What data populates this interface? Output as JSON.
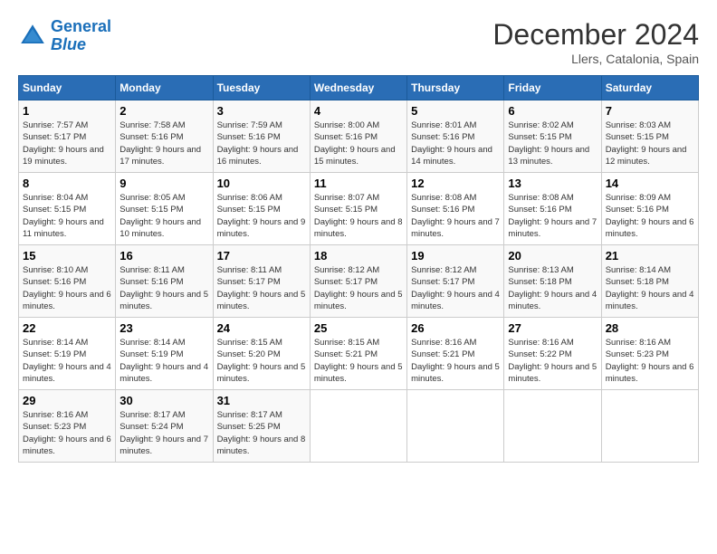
{
  "header": {
    "logo_line1": "General",
    "logo_line2": "Blue",
    "month": "December 2024",
    "location": "Llers, Catalonia, Spain"
  },
  "weekdays": [
    "Sunday",
    "Monday",
    "Tuesday",
    "Wednesday",
    "Thursday",
    "Friday",
    "Saturday"
  ],
  "weeks": [
    [
      {
        "day": "1",
        "info": "Sunrise: 7:57 AM\nSunset: 5:17 PM\nDaylight: 9 hours and 19 minutes."
      },
      {
        "day": "2",
        "info": "Sunrise: 7:58 AM\nSunset: 5:16 PM\nDaylight: 9 hours and 17 minutes."
      },
      {
        "day": "3",
        "info": "Sunrise: 7:59 AM\nSunset: 5:16 PM\nDaylight: 9 hours and 16 minutes."
      },
      {
        "day": "4",
        "info": "Sunrise: 8:00 AM\nSunset: 5:16 PM\nDaylight: 9 hours and 15 minutes."
      },
      {
        "day": "5",
        "info": "Sunrise: 8:01 AM\nSunset: 5:16 PM\nDaylight: 9 hours and 14 minutes."
      },
      {
        "day": "6",
        "info": "Sunrise: 8:02 AM\nSunset: 5:15 PM\nDaylight: 9 hours and 13 minutes."
      },
      {
        "day": "7",
        "info": "Sunrise: 8:03 AM\nSunset: 5:15 PM\nDaylight: 9 hours and 12 minutes."
      }
    ],
    [
      {
        "day": "8",
        "info": "Sunrise: 8:04 AM\nSunset: 5:15 PM\nDaylight: 9 hours and 11 minutes."
      },
      {
        "day": "9",
        "info": "Sunrise: 8:05 AM\nSunset: 5:15 PM\nDaylight: 9 hours and 10 minutes."
      },
      {
        "day": "10",
        "info": "Sunrise: 8:06 AM\nSunset: 5:15 PM\nDaylight: 9 hours and 9 minutes."
      },
      {
        "day": "11",
        "info": "Sunrise: 8:07 AM\nSunset: 5:15 PM\nDaylight: 9 hours and 8 minutes."
      },
      {
        "day": "12",
        "info": "Sunrise: 8:08 AM\nSunset: 5:16 PM\nDaylight: 9 hours and 7 minutes."
      },
      {
        "day": "13",
        "info": "Sunrise: 8:08 AM\nSunset: 5:16 PM\nDaylight: 9 hours and 7 minutes."
      },
      {
        "day": "14",
        "info": "Sunrise: 8:09 AM\nSunset: 5:16 PM\nDaylight: 9 hours and 6 minutes."
      }
    ],
    [
      {
        "day": "15",
        "info": "Sunrise: 8:10 AM\nSunset: 5:16 PM\nDaylight: 9 hours and 6 minutes."
      },
      {
        "day": "16",
        "info": "Sunrise: 8:11 AM\nSunset: 5:16 PM\nDaylight: 9 hours and 5 minutes."
      },
      {
        "day": "17",
        "info": "Sunrise: 8:11 AM\nSunset: 5:17 PM\nDaylight: 9 hours and 5 minutes."
      },
      {
        "day": "18",
        "info": "Sunrise: 8:12 AM\nSunset: 5:17 PM\nDaylight: 9 hours and 5 minutes."
      },
      {
        "day": "19",
        "info": "Sunrise: 8:12 AM\nSunset: 5:17 PM\nDaylight: 9 hours and 4 minutes."
      },
      {
        "day": "20",
        "info": "Sunrise: 8:13 AM\nSunset: 5:18 PM\nDaylight: 9 hours and 4 minutes."
      },
      {
        "day": "21",
        "info": "Sunrise: 8:14 AM\nSunset: 5:18 PM\nDaylight: 9 hours and 4 minutes."
      }
    ],
    [
      {
        "day": "22",
        "info": "Sunrise: 8:14 AM\nSunset: 5:19 PM\nDaylight: 9 hours and 4 minutes."
      },
      {
        "day": "23",
        "info": "Sunrise: 8:14 AM\nSunset: 5:19 PM\nDaylight: 9 hours and 4 minutes."
      },
      {
        "day": "24",
        "info": "Sunrise: 8:15 AM\nSunset: 5:20 PM\nDaylight: 9 hours and 5 minutes."
      },
      {
        "day": "25",
        "info": "Sunrise: 8:15 AM\nSunset: 5:21 PM\nDaylight: 9 hours and 5 minutes."
      },
      {
        "day": "26",
        "info": "Sunrise: 8:16 AM\nSunset: 5:21 PM\nDaylight: 9 hours and 5 minutes."
      },
      {
        "day": "27",
        "info": "Sunrise: 8:16 AM\nSunset: 5:22 PM\nDaylight: 9 hours and 5 minutes."
      },
      {
        "day": "28",
        "info": "Sunrise: 8:16 AM\nSunset: 5:23 PM\nDaylight: 9 hours and 6 minutes."
      }
    ],
    [
      {
        "day": "29",
        "info": "Sunrise: 8:16 AM\nSunset: 5:23 PM\nDaylight: 9 hours and 6 minutes."
      },
      {
        "day": "30",
        "info": "Sunrise: 8:17 AM\nSunset: 5:24 PM\nDaylight: 9 hours and 7 minutes."
      },
      {
        "day": "31",
        "info": "Sunrise: 8:17 AM\nSunset: 5:25 PM\nDaylight: 9 hours and 8 minutes."
      },
      null,
      null,
      null,
      null
    ]
  ]
}
